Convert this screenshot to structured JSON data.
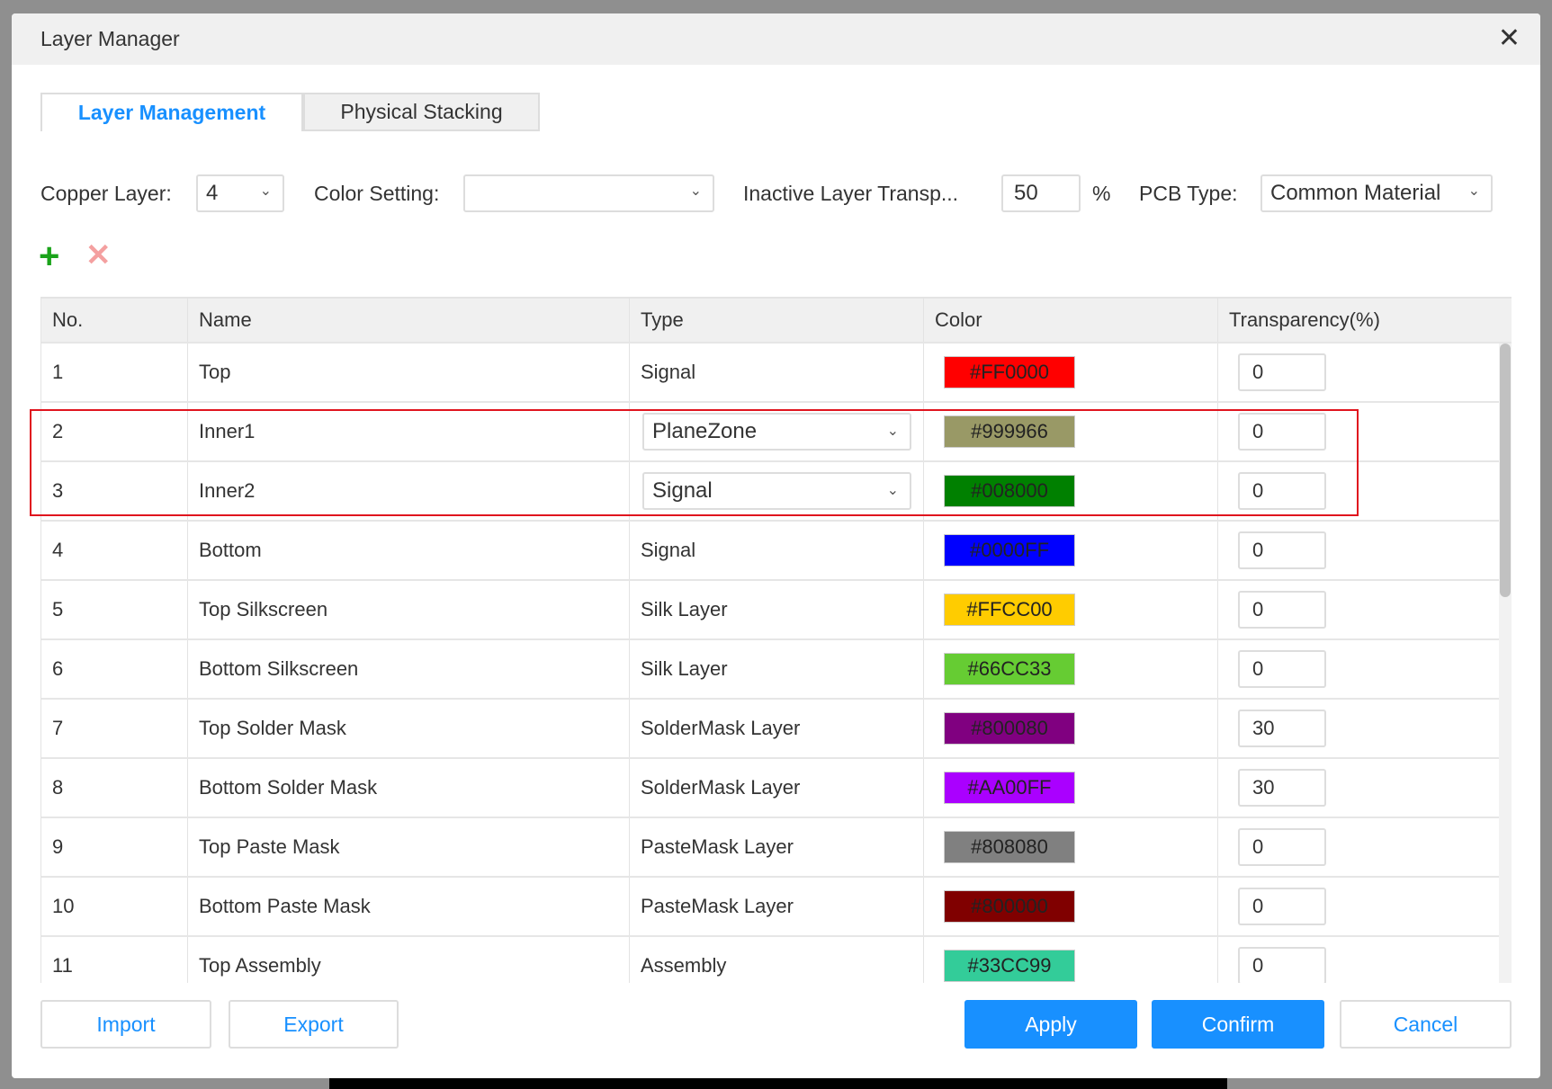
{
  "dialog": {
    "title": "Layer Manager",
    "close_icon": "close-icon"
  },
  "tabs": [
    "Layer Management",
    "Physical Stacking"
  ],
  "controls": {
    "copper_label": "Copper Layer:",
    "copper_value": "4",
    "color_label": "Color Setting:",
    "color_value": "",
    "transp_label": "Inactive Layer Transp...",
    "transp_value": "50",
    "percent": "%",
    "pcb_label": "PCB Type:",
    "pcb_value": "Common Material"
  },
  "table": {
    "headers": [
      "No.",
      "Name",
      "Type",
      "Color",
      "Transparency(%)"
    ],
    "rows": [
      {
        "no": "1",
        "name": "Top",
        "type": "Signal",
        "color": "#FF0000",
        "transparency": "0"
      },
      {
        "no": "2",
        "name": "Inner1",
        "type": "PlaneZone",
        "color": "#999966",
        "transparency": "0"
      },
      {
        "no": "3",
        "name": "Inner2",
        "type": "Signal",
        "color": "#008000",
        "transparency": "0"
      },
      {
        "no": "4",
        "name": "Bottom",
        "type": "Signal",
        "color": "#0000FF",
        "transparency": "0"
      },
      {
        "no": "5",
        "name": "Top Silkscreen",
        "type": "Silk Layer",
        "color": "#FFCC00",
        "transparency": "0"
      },
      {
        "no": "6",
        "name": "Bottom Silkscreen",
        "type": "Silk Layer",
        "color": "#66CC33",
        "transparency": "0"
      },
      {
        "no": "7",
        "name": "Top Solder Mask",
        "type": "SolderMask Layer",
        "color": "#800080",
        "transparency": "30"
      },
      {
        "no": "8",
        "name": "Bottom Solder Mask",
        "type": "SolderMask Layer",
        "color": "#AA00FF",
        "transparency": "30"
      },
      {
        "no": "9",
        "name": "Top Paste Mask",
        "type": "PasteMask Layer",
        "color": "#808080",
        "transparency": "0"
      },
      {
        "no": "10",
        "name": "Bottom Paste Mask",
        "type": "PasteMask Layer",
        "color": "#800000",
        "transparency": "0"
      },
      {
        "no": "11",
        "name": "Top Assembly",
        "type": "Assembly",
        "color": "#33CC99",
        "transparency": "0"
      }
    ]
  },
  "buttons": {
    "import": "Import",
    "export": "Export",
    "apply": "Apply",
    "confirm": "Confirm",
    "cancel": "Cancel"
  },
  "colors": {
    "accent": "#1890FF",
    "highlight": "#E0141E"
  }
}
